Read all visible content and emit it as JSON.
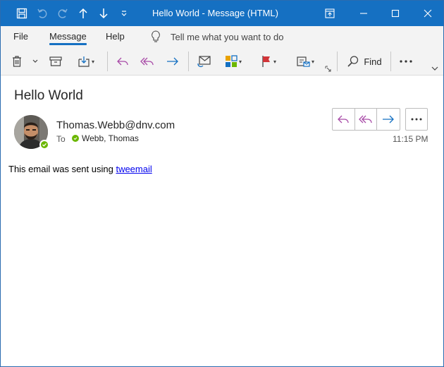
{
  "window": {
    "title": "Hello World  -  Message (HTML)"
  },
  "quick_access": [
    "save-icon",
    "undo-icon",
    "redo-icon",
    "previous-item-icon",
    "next-item-icon",
    "customize-toolbar-icon"
  ],
  "menu": {
    "tabs": [
      {
        "label": "File"
      },
      {
        "label": "Message",
        "active": true
      },
      {
        "label": "Help"
      }
    ],
    "tell_me": "Tell me what you want to do"
  },
  "ribbon": {
    "find_label": "Find"
  },
  "message": {
    "subject": "Hello World",
    "sender": "Thomas.Webb@dnv.com",
    "to_label": "To",
    "recipient": "Webb, Thomas",
    "time": "11:15 PM",
    "body_prefix": "This email was sent using ",
    "body_link": "tweemail"
  },
  "colors": {
    "titlebar": "#1570c2",
    "reply": "#a94ca8",
    "forward": "#1570c2",
    "presence": "#6bb700"
  }
}
